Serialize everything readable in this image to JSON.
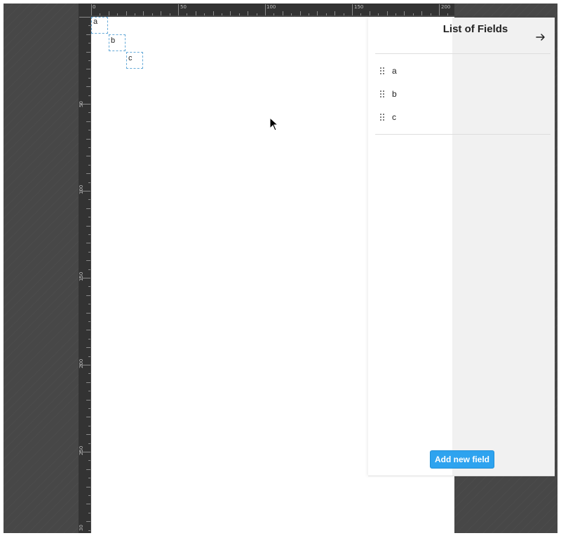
{
  "ruler": {
    "top_labels": [
      "0",
      "50",
      "100",
      "150",
      "200"
    ],
    "left_labels": [
      "50",
      "100",
      "150",
      "200",
      "250",
      "30"
    ]
  },
  "canvas": {
    "field_boxes": [
      {
        "label": "a"
      },
      {
        "label": "b"
      },
      {
        "label": "c"
      }
    ]
  },
  "panel": {
    "title": "List of Fields",
    "close_icon": "arrow-right-icon",
    "fields": [
      {
        "label": "a"
      },
      {
        "label": "b"
      },
      {
        "label": "c"
      }
    ],
    "add_button_label": "Add new field"
  },
  "colors": {
    "workspace": "#474747",
    "ruler": "#333333",
    "accent": "#2ea3ef",
    "field_outline": "#64a9d8"
  }
}
